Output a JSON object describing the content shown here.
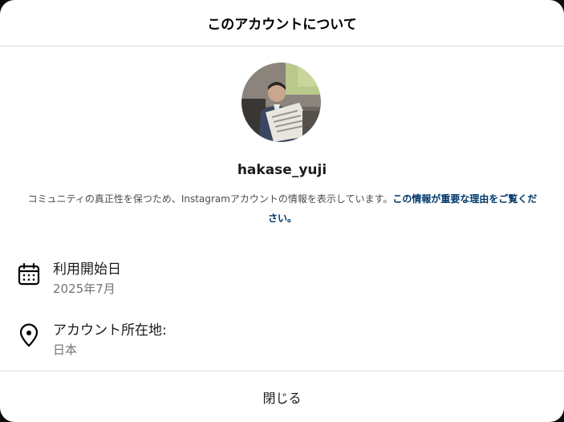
{
  "dialog": {
    "title": "このアカウントについて",
    "close_label": "閉じる"
  },
  "profile": {
    "username": "hakase_yuji",
    "avatar_icon": "profile-photo"
  },
  "description": {
    "text": "コミュニティの真正性を保つため、Instagramアカウントの情報を表示しています。",
    "link_text": "この情報が重要な理由をご覧ください。"
  },
  "info": [
    {
      "icon": "calendar-icon",
      "label": "利用開始日",
      "value": "2025年7月"
    },
    {
      "icon": "location-pin-icon",
      "label": "アカウント所在地:",
      "value": "日本"
    }
  ],
  "colors": {
    "link": "#00376b",
    "secondary_text": "#737373",
    "divider": "#dbdbdb",
    "background_outer": "#0d0d0d"
  }
}
